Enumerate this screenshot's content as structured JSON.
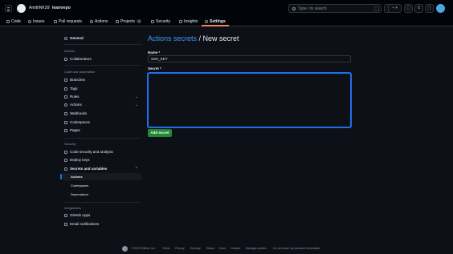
{
  "header": {
    "owner": "AmithNK20",
    "separator": "/",
    "repo": "learnrepo",
    "search_placeholder": "Type / to search",
    "plus_label": "+ ▾"
  },
  "tabs": [
    {
      "label": "Code"
    },
    {
      "label": "Issues"
    },
    {
      "label": "Pull requests"
    },
    {
      "label": "Actions"
    },
    {
      "label": "Projects",
      "count": "1"
    },
    {
      "label": "Security"
    },
    {
      "label": "Insights"
    },
    {
      "label": "Settings",
      "active": true
    }
  ],
  "sidebar": {
    "general": "General",
    "access_heading": "Access",
    "collaborators": "Collaborators",
    "automation_heading": "Code and automation",
    "branches": "Branches",
    "tags": "Tags",
    "rules": "Rules",
    "actions": "Actions",
    "webhooks": "Webhooks",
    "codespaces": "Codespaces",
    "pages": "Pages",
    "security_heading": "Security",
    "code_security": "Code security and analysis",
    "deploy_keys": "Deploy keys",
    "secrets_variables": "Secrets and variables",
    "sub_actions": "Actions",
    "sub_codespaces": "Codespaces",
    "sub_dependabot": "Dependabot",
    "integrations_heading": "Integrations",
    "github_apps": "GitHub Apps",
    "email_notifications": "Email notifications"
  },
  "main": {
    "breadcrumb_link": "Actions secrets",
    "breadcrumb_current": " / New secret",
    "name_label": "Name *",
    "name_value": "SSH_KEY",
    "secret_label": "Secret *",
    "secret_value": "",
    "add_button": "Add secret"
  },
  "footer": {
    "copyright": "© 2023 GitHub, Inc.",
    "links": [
      "Terms",
      "Privacy",
      "Security",
      "Status",
      "Docs",
      "Contact",
      "Manage cookies",
      "Do not share my personal information"
    ]
  },
  "colors": {
    "background": "#0d1117",
    "header": "#010409",
    "accent_blue": "#4493f8",
    "button_green": "#238636",
    "tab_underline": "#f78166"
  }
}
